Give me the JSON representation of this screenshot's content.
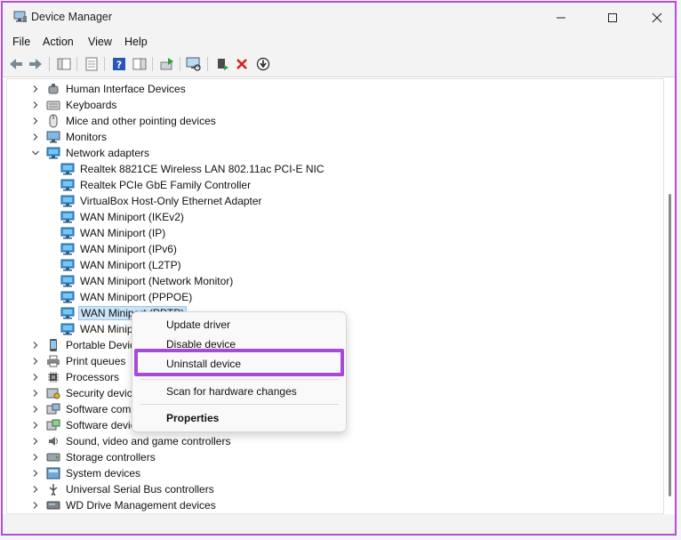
{
  "window": {
    "title": "Device Manager"
  },
  "menu": [
    "File",
    "Action",
    "View",
    "Help"
  ],
  "toolbar_icons": [
    "back-arrow-icon",
    "forward-arrow-icon",
    "show-hide-tree-icon",
    "properties-icon",
    "help-icon",
    "action-pane-icon",
    "update-driver-icon",
    "scan-hardware-icon",
    "enable-device-icon",
    "uninstall-icon",
    "download-driver-icon"
  ],
  "tree": [
    {
      "label": "Human Interface Devices",
      "icon": "hid-icon",
      "expanded": false,
      "level": 0
    },
    {
      "label": "Keyboards",
      "icon": "keyboard-icon",
      "expanded": false,
      "level": 0
    },
    {
      "label": "Mice and other pointing devices",
      "icon": "mouse-icon",
      "expanded": false,
      "level": 0
    },
    {
      "label": "Monitors",
      "icon": "monitor-icon",
      "expanded": false,
      "level": 0
    },
    {
      "label": "Network adapters",
      "icon": "network-adapter-icon",
      "expanded": true,
      "level": 0
    },
    {
      "label": "Realtek 8821CE Wireless LAN 802.11ac PCI-E NIC",
      "icon": "network-adapter-icon",
      "level": 1
    },
    {
      "label": "Realtek PCIe GbE Family Controller",
      "icon": "network-adapter-icon",
      "level": 1
    },
    {
      "label": "VirtualBox Host-Only Ethernet Adapter",
      "icon": "network-adapter-icon",
      "level": 1
    },
    {
      "label": "WAN Miniport (IKEv2)",
      "icon": "network-adapter-icon",
      "level": 1
    },
    {
      "label": "WAN Miniport (IP)",
      "icon": "network-adapter-icon",
      "level": 1
    },
    {
      "label": "WAN Miniport (IPv6)",
      "icon": "network-adapter-icon",
      "level": 1
    },
    {
      "label": "WAN Miniport (L2TP)",
      "icon": "network-adapter-icon",
      "level": 1
    },
    {
      "label": "WAN Miniport (Network Monitor)",
      "icon": "network-adapter-icon",
      "level": 1
    },
    {
      "label": "WAN Miniport (PPPOE)",
      "icon": "network-adapter-icon",
      "level": 1
    },
    {
      "label": "WAN Miniport (PPTP)",
      "icon": "network-adapter-icon",
      "level": 1,
      "selected": true
    },
    {
      "label": "WAN Minip",
      "icon": "network-adapter-icon",
      "level": 1
    },
    {
      "label": "Portable Device",
      "icon": "portable-device-icon",
      "expanded": false,
      "level": 0
    },
    {
      "label": "Print queues",
      "icon": "printer-icon",
      "expanded": false,
      "level": 0
    },
    {
      "label": "Processors",
      "icon": "processor-icon",
      "expanded": false,
      "level": 0
    },
    {
      "label": "Security devices",
      "icon": "security-device-icon",
      "expanded": false,
      "level": 0
    },
    {
      "label": "Software comp",
      "icon": "software-component-icon",
      "expanded": false,
      "level": 0
    },
    {
      "label": "Software device",
      "icon": "software-device-icon",
      "expanded": false,
      "level": 0
    },
    {
      "label": "Sound, video and game controllers",
      "icon": "speaker-icon",
      "expanded": false,
      "level": 0
    },
    {
      "label": "Storage controllers",
      "icon": "storage-icon",
      "expanded": false,
      "level": 0
    },
    {
      "label": "System devices",
      "icon": "system-device-icon",
      "expanded": false,
      "level": 0
    },
    {
      "label": "Universal Serial Bus controllers",
      "icon": "usb-icon",
      "expanded": false,
      "level": 0
    },
    {
      "label": "WD Drive Management devices",
      "icon": "drive-icon",
      "expanded": false,
      "level": 0
    }
  ],
  "context_menu": {
    "update": "Update driver",
    "disable": "Disable device",
    "uninstall": "Uninstall device",
    "scan": "Scan for hardware changes",
    "properties": "Properties"
  },
  "colors": {
    "highlight": "#a64ad8",
    "selection": "#cce4f7",
    "accent": "#0a64c8"
  }
}
